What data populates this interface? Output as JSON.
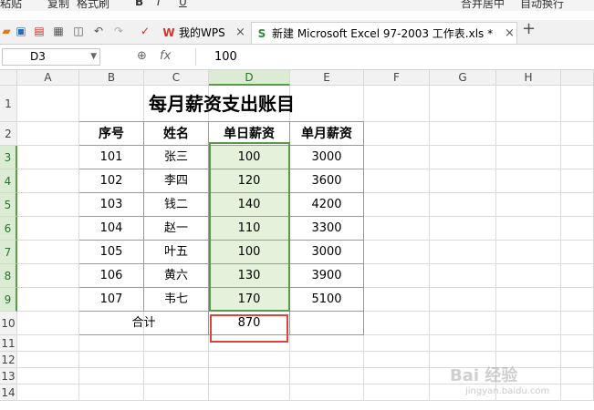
{
  "toolbar": {
    "items": [
      "粘贴",
      "复制",
      "格式刷",
      "B",
      "I",
      "U",
      "合并居中",
      "自动换行"
    ]
  },
  "tabs": [
    {
      "label": "我的WPS",
      "icon": "W"
    },
    {
      "label": "新建 Microsoft Excel 97-2003 工作表.xls *",
      "icon": "S"
    }
  ],
  "formula_bar": {
    "name_box": "D3",
    "fx_label": "fx",
    "value": "100"
  },
  "columns": [
    "A",
    "B",
    "C",
    "D",
    "E",
    "F",
    "G",
    "H"
  ],
  "rows": [
    "1",
    "2",
    "3",
    "4",
    "5",
    "6",
    "7",
    "8",
    "9",
    "10",
    "11",
    "12",
    "13",
    "14"
  ],
  "sheet": {
    "title": "每月薪资支出账目",
    "headers": [
      "序号",
      "姓名",
      "单日薪资",
      "单月薪资"
    ],
    "records": [
      [
        "101",
        "张三",
        "100",
        "3000"
      ],
      [
        "102",
        "李四",
        "120",
        "3600"
      ],
      [
        "103",
        "钱二",
        "140",
        "4200"
      ],
      [
        "104",
        "赵一",
        "110",
        "3300"
      ],
      [
        "105",
        "叶五",
        "100",
        "3000"
      ],
      [
        "106",
        "黄六",
        "130",
        "3900"
      ],
      [
        "107",
        "韦七",
        "170",
        "5100"
      ]
    ],
    "total_label": "合计",
    "total_value": "870"
  },
  "selection": {
    "active_cell": "D3",
    "range": "D3:D9"
  },
  "colors": {
    "selection": "#5a9a48",
    "selection_fill": "#e4f2dc",
    "highlight": "#e0413a"
  },
  "watermark": {
    "text": "Bai 经验",
    "sub": "jingyan.baidu.com"
  }
}
